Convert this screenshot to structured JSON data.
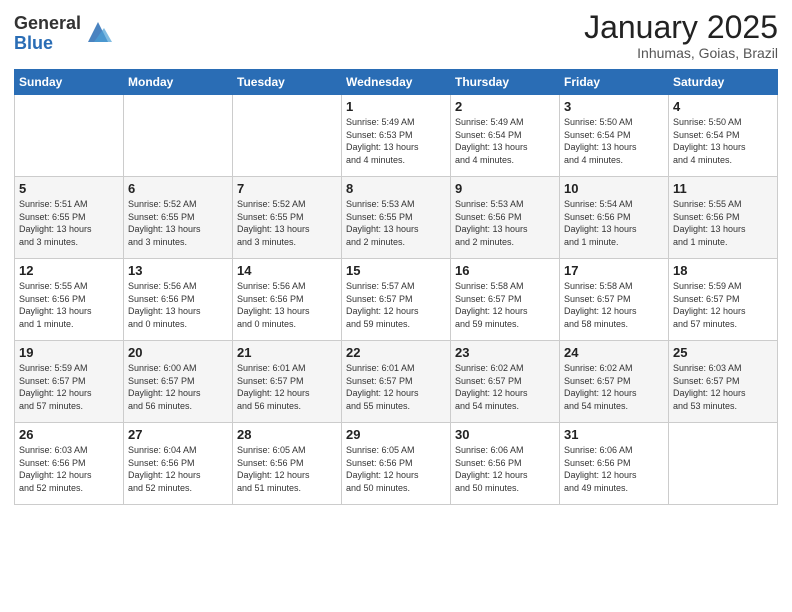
{
  "header": {
    "logo_general": "General",
    "logo_blue": "Blue",
    "title": "January 2025",
    "location": "Inhumas, Goias, Brazil"
  },
  "days_of_week": [
    "Sunday",
    "Monday",
    "Tuesday",
    "Wednesday",
    "Thursday",
    "Friday",
    "Saturday"
  ],
  "weeks": [
    [
      {
        "day": "",
        "info": ""
      },
      {
        "day": "",
        "info": ""
      },
      {
        "day": "",
        "info": ""
      },
      {
        "day": "1",
        "info": "Sunrise: 5:49 AM\nSunset: 6:53 PM\nDaylight: 13 hours\nand 4 minutes."
      },
      {
        "day": "2",
        "info": "Sunrise: 5:49 AM\nSunset: 6:54 PM\nDaylight: 13 hours\nand 4 minutes."
      },
      {
        "day": "3",
        "info": "Sunrise: 5:50 AM\nSunset: 6:54 PM\nDaylight: 13 hours\nand 4 minutes."
      },
      {
        "day": "4",
        "info": "Sunrise: 5:50 AM\nSunset: 6:54 PM\nDaylight: 13 hours\nand 4 minutes."
      }
    ],
    [
      {
        "day": "5",
        "info": "Sunrise: 5:51 AM\nSunset: 6:55 PM\nDaylight: 13 hours\nand 3 minutes."
      },
      {
        "day": "6",
        "info": "Sunrise: 5:52 AM\nSunset: 6:55 PM\nDaylight: 13 hours\nand 3 minutes."
      },
      {
        "day": "7",
        "info": "Sunrise: 5:52 AM\nSunset: 6:55 PM\nDaylight: 13 hours\nand 3 minutes."
      },
      {
        "day": "8",
        "info": "Sunrise: 5:53 AM\nSunset: 6:55 PM\nDaylight: 13 hours\nand 2 minutes."
      },
      {
        "day": "9",
        "info": "Sunrise: 5:53 AM\nSunset: 6:56 PM\nDaylight: 13 hours\nand 2 minutes."
      },
      {
        "day": "10",
        "info": "Sunrise: 5:54 AM\nSunset: 6:56 PM\nDaylight: 13 hours\nand 1 minute."
      },
      {
        "day": "11",
        "info": "Sunrise: 5:55 AM\nSunset: 6:56 PM\nDaylight: 13 hours\nand 1 minute."
      }
    ],
    [
      {
        "day": "12",
        "info": "Sunrise: 5:55 AM\nSunset: 6:56 PM\nDaylight: 13 hours\nand 1 minute."
      },
      {
        "day": "13",
        "info": "Sunrise: 5:56 AM\nSunset: 6:56 PM\nDaylight: 13 hours\nand 0 minutes."
      },
      {
        "day": "14",
        "info": "Sunrise: 5:56 AM\nSunset: 6:56 PM\nDaylight: 13 hours\nand 0 minutes."
      },
      {
        "day": "15",
        "info": "Sunrise: 5:57 AM\nSunset: 6:57 PM\nDaylight: 12 hours\nand 59 minutes."
      },
      {
        "day": "16",
        "info": "Sunrise: 5:58 AM\nSunset: 6:57 PM\nDaylight: 12 hours\nand 59 minutes."
      },
      {
        "day": "17",
        "info": "Sunrise: 5:58 AM\nSunset: 6:57 PM\nDaylight: 12 hours\nand 58 minutes."
      },
      {
        "day": "18",
        "info": "Sunrise: 5:59 AM\nSunset: 6:57 PM\nDaylight: 12 hours\nand 57 minutes."
      }
    ],
    [
      {
        "day": "19",
        "info": "Sunrise: 5:59 AM\nSunset: 6:57 PM\nDaylight: 12 hours\nand 57 minutes."
      },
      {
        "day": "20",
        "info": "Sunrise: 6:00 AM\nSunset: 6:57 PM\nDaylight: 12 hours\nand 56 minutes."
      },
      {
        "day": "21",
        "info": "Sunrise: 6:01 AM\nSunset: 6:57 PM\nDaylight: 12 hours\nand 56 minutes."
      },
      {
        "day": "22",
        "info": "Sunrise: 6:01 AM\nSunset: 6:57 PM\nDaylight: 12 hours\nand 55 minutes."
      },
      {
        "day": "23",
        "info": "Sunrise: 6:02 AM\nSunset: 6:57 PM\nDaylight: 12 hours\nand 54 minutes."
      },
      {
        "day": "24",
        "info": "Sunrise: 6:02 AM\nSunset: 6:57 PM\nDaylight: 12 hours\nand 54 minutes."
      },
      {
        "day": "25",
        "info": "Sunrise: 6:03 AM\nSunset: 6:57 PM\nDaylight: 12 hours\nand 53 minutes."
      }
    ],
    [
      {
        "day": "26",
        "info": "Sunrise: 6:03 AM\nSunset: 6:56 PM\nDaylight: 12 hours\nand 52 minutes."
      },
      {
        "day": "27",
        "info": "Sunrise: 6:04 AM\nSunset: 6:56 PM\nDaylight: 12 hours\nand 52 minutes."
      },
      {
        "day": "28",
        "info": "Sunrise: 6:05 AM\nSunset: 6:56 PM\nDaylight: 12 hours\nand 51 minutes."
      },
      {
        "day": "29",
        "info": "Sunrise: 6:05 AM\nSunset: 6:56 PM\nDaylight: 12 hours\nand 50 minutes."
      },
      {
        "day": "30",
        "info": "Sunrise: 6:06 AM\nSunset: 6:56 PM\nDaylight: 12 hours\nand 50 minutes."
      },
      {
        "day": "31",
        "info": "Sunrise: 6:06 AM\nSunset: 6:56 PM\nDaylight: 12 hours\nand 49 minutes."
      },
      {
        "day": "",
        "info": ""
      }
    ]
  ]
}
